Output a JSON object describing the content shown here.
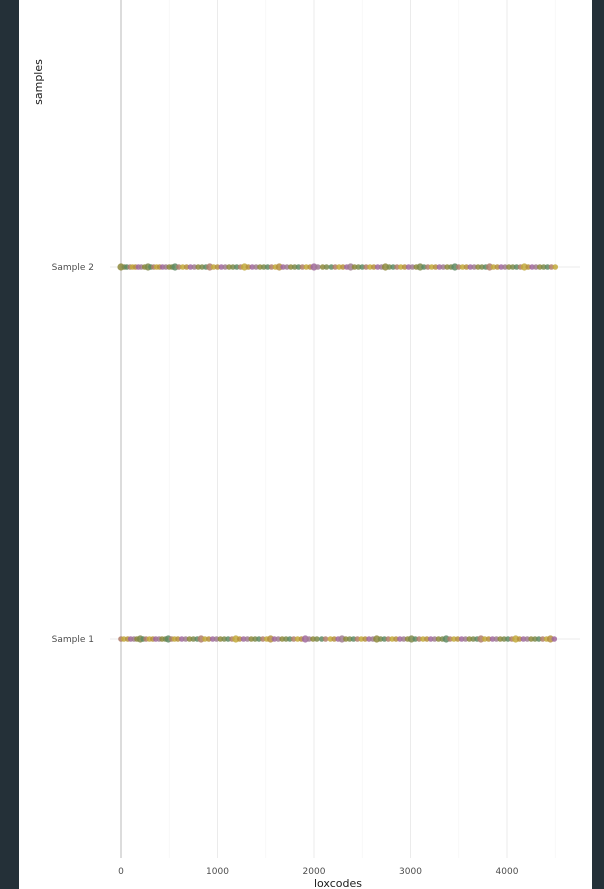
{
  "chart_data": {
    "type": "scatter",
    "title": "",
    "xlabel": "loxcodes",
    "ylabel": "samples",
    "xlim": [
      -120,
      4700
    ],
    "x_ticks": [
      "0",
      "1000",
      "2000",
      "3000",
      "4000"
    ],
    "x_tick_values": [
      0,
      1000,
      2000,
      3000,
      4000
    ],
    "categories": [
      "Sample 1",
      "Sample 2"
    ],
    "grid": true,
    "point_colors": [
      "#8e8a3c",
      "#b07c6a",
      "#a0699e",
      "#7d8a4a",
      "#c2a93a",
      "#9f7a8f",
      "#5e8a63",
      "#b58f3d"
    ],
    "series": [
      {
        "category": "Sample 2",
        "x": [
          0,
          35,
          60,
          95,
          120,
          150,
          180,
          210,
          245,
          280,
          310,
          340,
          370,
          400,
          430,
          465,
          500,
          530,
          560,
          600,
          640,
          680,
          720,
          760,
          800,
          840,
          880,
          920,
          960,
          1000,
          1040,
          1080,
          1120,
          1160,
          1200,
          1240,
          1280,
          1320,
          1360,
          1400,
          1440,
          1480,
          1520,
          1560,
          1600,
          1640,
          1680,
          1720,
          1760,
          1800,
          1840,
          1880,
          1920,
          1960,
          2000,
          2040,
          2090,
          2130,
          2180,
          2220,
          2260,
          2300,
          2340,
          2380,
          2420,
          2460,
          2500,
          2540,
          2580,
          2620,
          2660,
          2700,
          2740,
          2780,
          2820,
          2860,
          2900,
          2940,
          2980,
          3020,
          3060,
          3100,
          3140,
          3180,
          3220,
          3260,
          3300,
          3340,
          3380,
          3420,
          3460,
          3500,
          3540,
          3580,
          3620,
          3660,
          3700,
          3740,
          3780,
          3820,
          3860,
          3900,
          3940,
          3980,
          4020,
          4060,
          4100,
          4140,
          4180,
          4220,
          4260,
          4300,
          4340,
          4380,
          4420,
          4460,
          4500
        ]
      },
      {
        "category": "Sample 1",
        "x": [
          0,
          30,
          70,
          100,
          135,
          165,
          200,
          230,
          260,
          295,
          330,
          360,
          395,
          425,
          460,
          490,
          525,
          555,
          590,
          630,
          670,
          710,
          750,
          790,
          830,
          870,
          910,
          950,
          990,
          1030,
          1070,
          1110,
          1150,
          1190,
          1230,
          1270,
          1310,
          1350,
          1390,
          1430,
          1470,
          1510,
          1550,
          1590,
          1630,
          1670,
          1710,
          1750,
          1790,
          1830,
          1870,
          1910,
          1950,
          1990,
          2030,
          2080,
          2120,
          2170,
          2210,
          2250,
          2290,
          2330,
          2370,
          2410,
          2450,
          2490,
          2530,
          2570,
          2610,
          2650,
          2690,
          2730,
          2770,
          2810,
          2850,
          2890,
          2930,
          2970,
          3010,
          3050,
          3090,
          3130,
          3170,
          3210,
          3250,
          3290,
          3330,
          3370,
          3410,
          3450,
          3490,
          3530,
          3570,
          3610,
          3650,
          3690,
          3730,
          3770,
          3810,
          3850,
          3890,
          3930,
          3970,
          4010,
          4050,
          4090,
          4130,
          4170,
          4210,
          4250,
          4290,
          4330,
          4370,
          4410,
          4450,
          4490
        ]
      }
    ]
  }
}
